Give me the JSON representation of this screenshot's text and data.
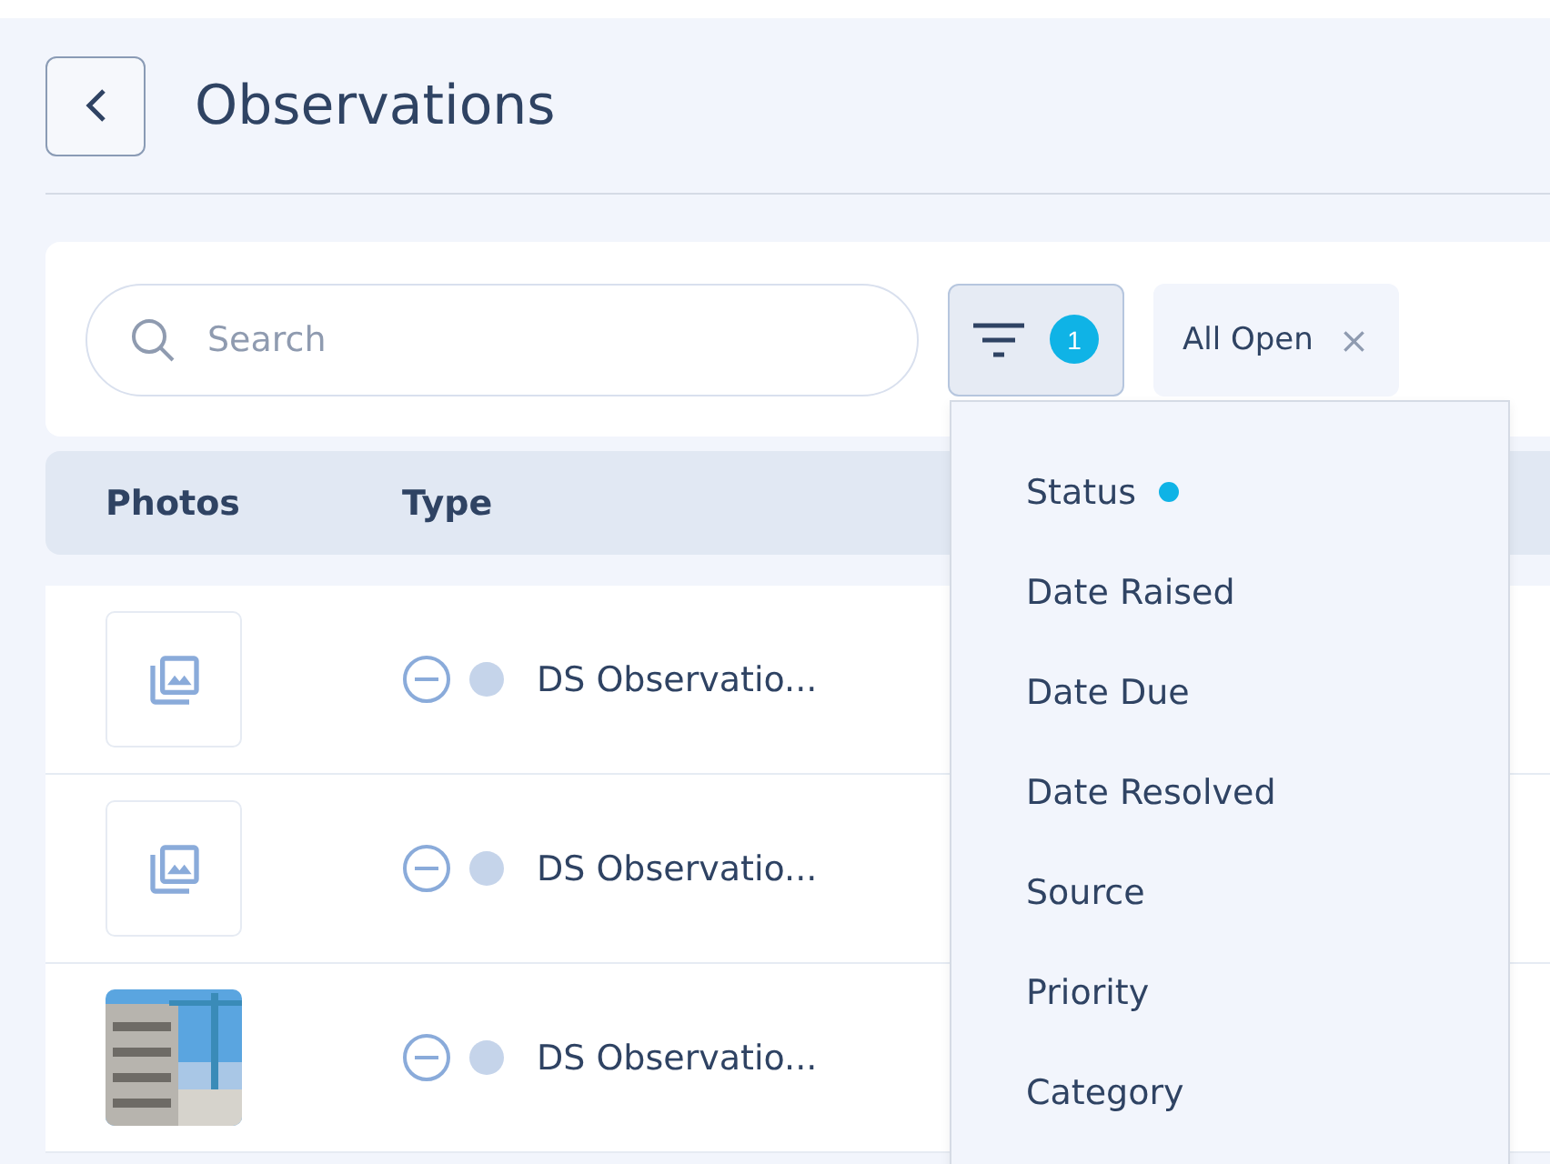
{
  "header": {
    "title": "Observations"
  },
  "toolbar": {
    "search": {
      "placeholder": "Search"
    },
    "filter_count": "1",
    "chips": [
      {
        "label": "All Open",
        "close": "×"
      }
    ]
  },
  "table": {
    "columns": [
      "Photos",
      "Type"
    ],
    "rows": [
      {
        "photo": {
          "kind": "placeholder"
        },
        "type": "DS Observatio..."
      },
      {
        "photo": {
          "kind": "placeholder"
        },
        "type": "DS Observatio..."
      },
      {
        "type": "DS Observatio..."
      }
    ]
  },
  "filter_menu": {
    "items": [
      {
        "label": "Status",
        "active": true
      },
      {
        "label": "Date Raised",
        "active": false
      },
      {
        "label": "Date Due",
        "active": false
      },
      {
        "label": "Date Resolved",
        "active": false
      },
      {
        "label": "Source",
        "active": false
      },
      {
        "label": "Priority",
        "active": false
      },
      {
        "label": "Category",
        "active": false
      }
    ]
  }
}
